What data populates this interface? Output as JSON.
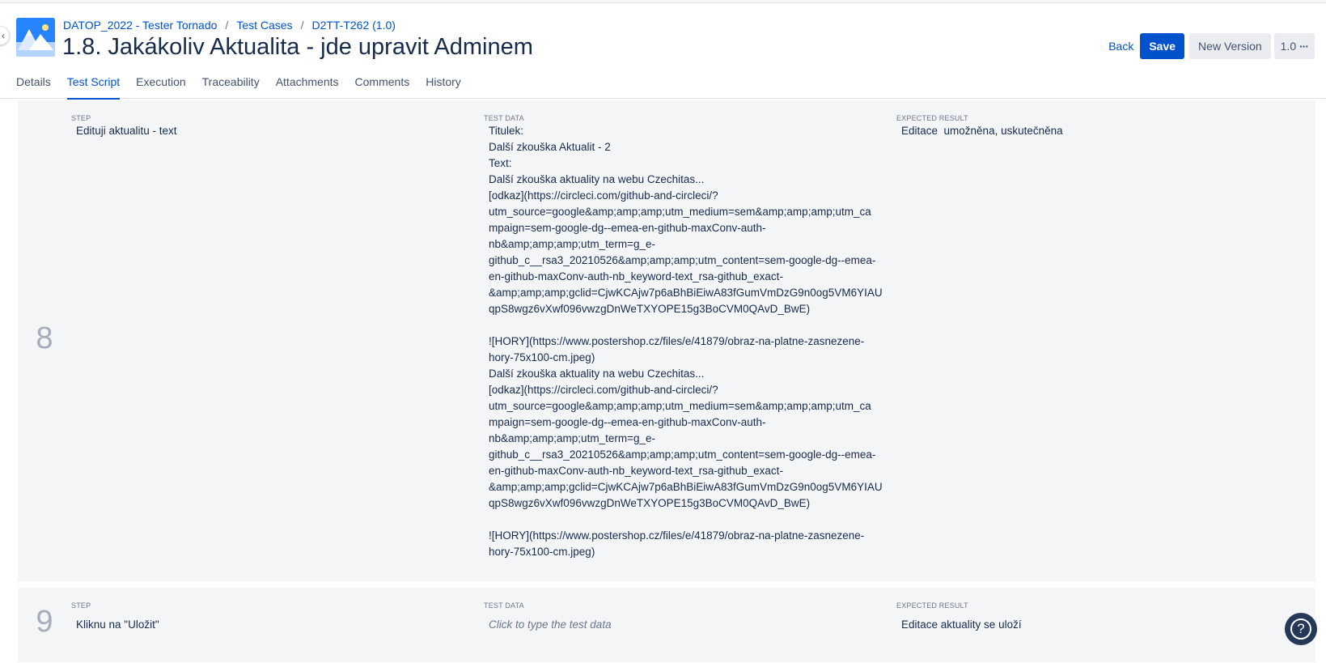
{
  "breadcrumb": {
    "project": "DATOP_2022 - Tester Tornado",
    "section": "Test Cases",
    "key": "D2TT-T262 (1.0)",
    "separator": "/"
  },
  "page_title": "1.8. Jakákoliv Aktualita - jde upravit Adminem",
  "actions": {
    "back_label": "Back",
    "save_label": "Save",
    "new_version_label": "New Version",
    "version_label": "1.0",
    "more_label": "···"
  },
  "tabs": [
    {
      "label": "Details",
      "active": false
    },
    {
      "label": "Test Script",
      "active": true
    },
    {
      "label": "Execution",
      "active": false
    },
    {
      "label": "Traceability",
      "active": false
    },
    {
      "label": "Attachments",
      "active": false
    },
    {
      "label": "Comments",
      "active": false
    },
    {
      "label": "History",
      "active": false
    }
  ],
  "columns": {
    "step": "STEP",
    "test_data": "TEST DATA",
    "expected_result": "EXPECTED RESULT"
  },
  "steps": [
    {
      "number": "8",
      "step": "Edituji aktualitu - text",
      "test_data": "Titulek:\nDalší zkouška Aktualit - 2\nText:\nDalší zkouška aktuality na webu Czechitas...\n[odkaz](https://circleci.com/github-and-circleci/?\nutm_source=google&amp;amp;amp;utm_medium=sem&amp;amp;amp;utm_ca\nmpaign=sem-google-dg--emea-en-github-maxConv-auth-\nnb&amp;amp;amp;utm_term=g_e-\ngithub_c__rsa3_20210526&amp;amp;amp;utm_content=sem-google-dg--emea-\nen-github-maxConv-auth-nb_keyword-text_rsa-github_exact-\n&amp;amp;amp;gclid=CjwKCAjw7p6aBhBiEiwA83fGumVmDzG9n0og5VM6YIAU\nqpS8wgz6vXwf096vwzgDnWeTXYOPE15g3BoCVM0QAvD_BwE)\n\n![HORY](https://www.postershop.cz/files/e/41879/obraz-na-platne-zasnezene-\nhory-75x100-cm.jpeg)\nDalší zkouška aktuality na webu Czechitas...\n[odkaz](https://circleci.com/github-and-circleci/?\nutm_source=google&amp;amp;amp;utm_medium=sem&amp;amp;amp;utm_ca\nmpaign=sem-google-dg--emea-en-github-maxConv-auth-\nnb&amp;amp;amp;utm_term=g_e-\ngithub_c__rsa3_20210526&amp;amp;amp;utm_content=sem-google-dg--emea-\nen-github-maxConv-auth-nb_keyword-text_rsa-github_exact-\n&amp;amp;amp;gclid=CjwKCAjw7p6aBhBiEiwA83fGumVmDzG9n0og5VM6YIAU\nqpS8wgz6vXwf096vwzgDnWeTXYOPE15g3BoCVM0QAvD_BwE)\n\n![HORY](https://www.postershop.cz/files/e/41879/obraz-na-platne-zasnezene-\nhory-75x100-cm.jpeg)",
      "expected_result": "Editace  umožněna, uskutečněna"
    },
    {
      "number": "9",
      "step": "Kliknu na \"Uložit\"",
      "test_data_placeholder": "Click to type the test data",
      "expected_result": "Editace aktuality se uloží"
    }
  ],
  "icons": {
    "collapse": "chevron-left-icon",
    "logo": "project-mountain-logo",
    "help": "help-icon"
  },
  "colors": {
    "accent": "#0052cc",
    "row_background": "#f4f5f7",
    "help_button": "#253858"
  }
}
